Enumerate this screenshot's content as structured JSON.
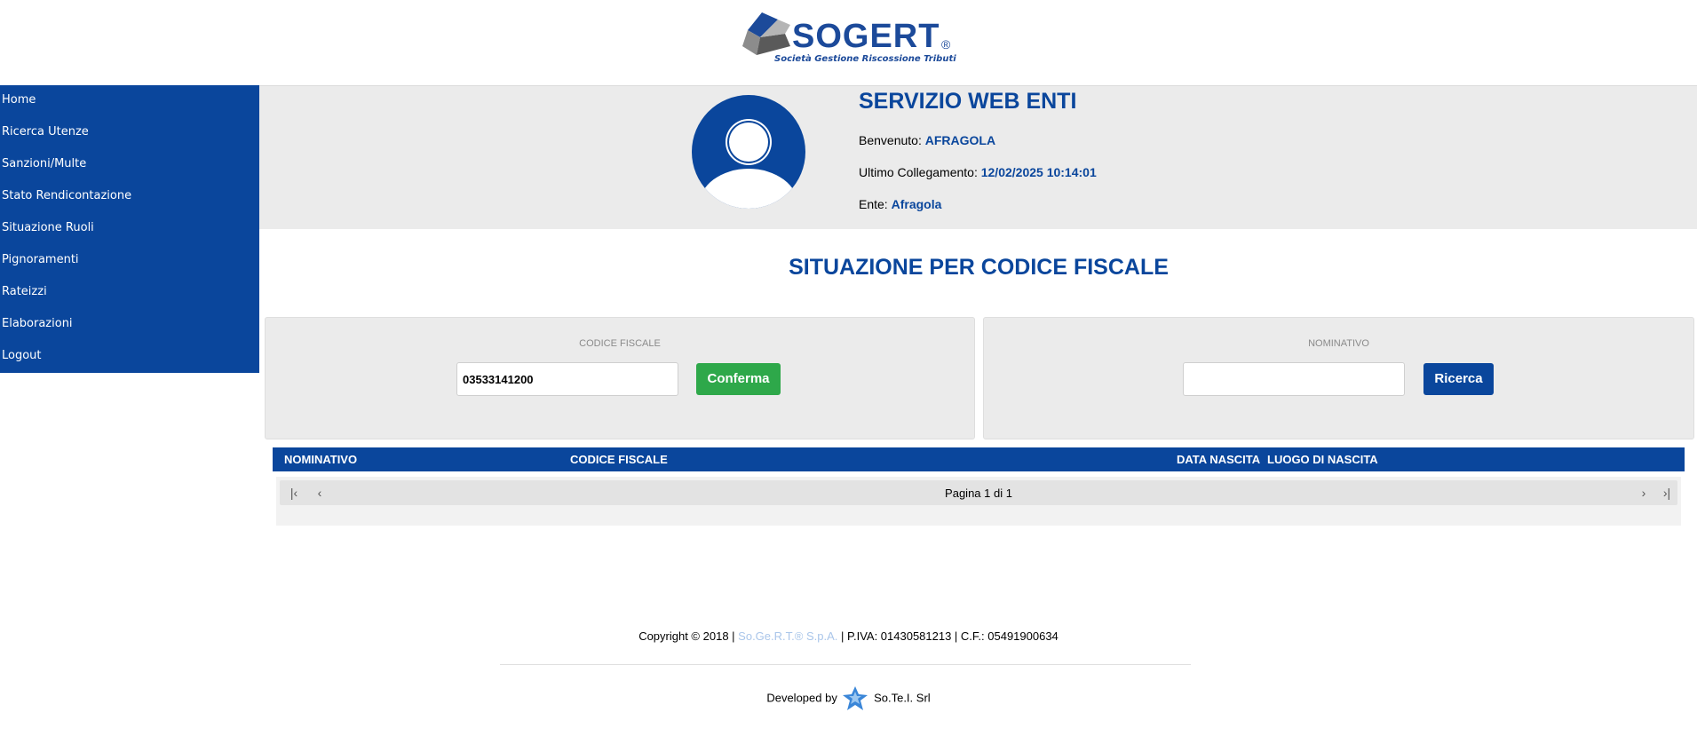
{
  "header": {
    "logo_word": "SOGERT",
    "logo_reg": "®",
    "logo_tagline": "Società Gestione Riscossione Tributi",
    "brand_color": "#0a469c"
  },
  "sidebar": {
    "items": [
      {
        "label": "Home"
      },
      {
        "label": "Ricerca Utenze"
      },
      {
        "label": "Sanzioni/Multe"
      },
      {
        "label": "Stato Rendicontazione"
      },
      {
        "label": "Situazione Ruoli"
      },
      {
        "label": "Pignoramenti"
      },
      {
        "label": "Rateizzi"
      },
      {
        "label": "Elaborazioni"
      },
      {
        "label": "Logout"
      }
    ]
  },
  "user_info": {
    "title": "SERVIZIO WEB ENTI",
    "welcome_label": "Benvenuto:",
    "welcome_value": "AFRAGOLA",
    "last_login_label": "Ultimo Collegamento:",
    "last_login_value": "12/02/2025 10:14:01",
    "ente_label": "Ente:",
    "ente_value": "Afragola",
    "avatar_icon": "user-avatar-icon"
  },
  "page": {
    "title": "SITUAZIONE PER CODICE FISCALE"
  },
  "search_cf": {
    "label": "CODICE FISCALE",
    "value": "03533141200",
    "button": "Conferma",
    "button_color": "#2ea84a"
  },
  "search_nominativo": {
    "label": "NOMINATIVO",
    "value": "",
    "button": "Ricerca"
  },
  "grid": {
    "columns": [
      "NOMINATIVO",
      "CODICE FISCALE",
      "DATA NASCITA",
      "LUOGO DI NASCITA"
    ],
    "rows": [],
    "pager_text": "Pagina 1 di 1"
  },
  "footer": {
    "copyright_prefix": "Copyright © 2018 |",
    "company_link": "So.Ge.R.T.® S.p.A.",
    "copyright_suffix": "| P.IVA: 01430581213 | C.F.: 05491900634",
    "developed_by": "Developed by",
    "developer": "So.Te.I. Srl"
  }
}
